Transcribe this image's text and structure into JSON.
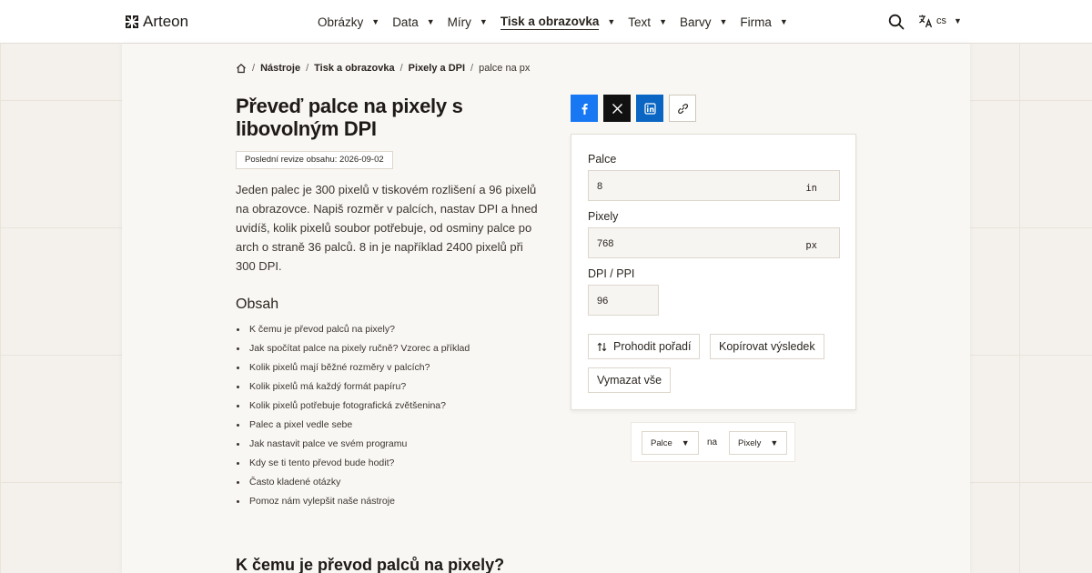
{
  "header": {
    "brand": "Arteon",
    "nav": [
      {
        "label": "Obrázky",
        "active": false
      },
      {
        "label": "Data",
        "active": false
      },
      {
        "label": "Míry",
        "active": false
      },
      {
        "label": "Tisk a obrazovka",
        "active": true
      },
      {
        "label": "Text",
        "active": false
      },
      {
        "label": "Barvy",
        "active": false
      },
      {
        "label": "Firma",
        "active": false
      }
    ],
    "language": "cs"
  },
  "breadcrumb": {
    "items": [
      "Nástroje",
      "Tisk a obrazovka",
      "Pixely a DPI"
    ],
    "current": "palce na px"
  },
  "title": "Převeď palce na pixely s libovolným DPI",
  "revision": "Poslední revize obsahu: 2026-09-02",
  "intro": "Jeden palec je 300 pixelů v tiskovém rozlišení a 96 pixelů na obrazovce. Napiš rozměr v palcích, nastav DPI a hned uvidíš, kolik pixelů soubor potřebuje, od osminy palce po arch o straně 36 palců. 8 in je například 2400 pixelů při 300 DPI.",
  "toc": {
    "heading": "Obsah",
    "items": [
      "K čemu je převod palců na pixely?",
      "Jak spočítat palce na pixely ručně? Vzorec a příklad",
      "Kolik pixelů mají běžné rozměry v palcích?",
      "Kolik pixelů má každý formát papíru?",
      "Kolik pixelů potřebuje fotografická zvětšenina?",
      "Palec a pixel vedle sebe",
      "Jak nastavit palce ve svém programu",
      "Kdy se ti tento převod bude hodit?",
      "Často kladené otázky",
      "Pomoz nám vylepšit naše nástroje"
    ]
  },
  "section_heading": "K čemu je převod palců na pixely?",
  "converter": {
    "inches_label": "Palce",
    "inches_value": "8",
    "inches_unit": "in",
    "pixels_label": "Pixely",
    "pixels_value": "768",
    "pixels_unit": "px",
    "dpi_label": "DPI / PPI",
    "dpi_value": "96",
    "swap_label": "Prohodit pořadí",
    "copy_label": "Kopírovat výsledek",
    "clear_label": "Vymazat vše"
  },
  "unit_selector": {
    "from": "Palce",
    "connector": "na",
    "to": "Pixely"
  },
  "colors": {
    "facebook": "#1877f2",
    "x": "#111111",
    "linkedin": "#0a66c2",
    "background": "#f4f1ec"
  }
}
